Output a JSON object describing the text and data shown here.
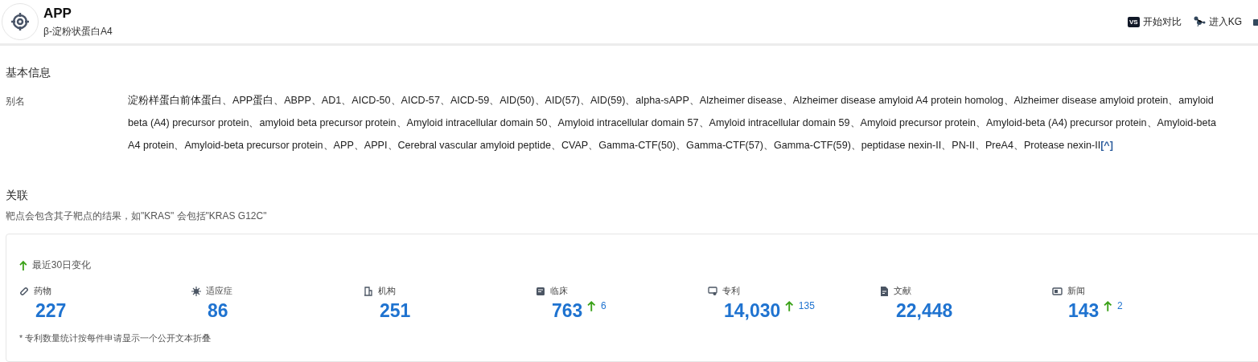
{
  "header": {
    "title": "APP",
    "subtitle": "β-淀粉状蛋白A4",
    "actions": [
      {
        "badge": "VS",
        "label": "开始对比"
      },
      {
        "label": "进入KG"
      }
    ]
  },
  "basic_info": {
    "heading": "基本信息",
    "alias_label": "别名",
    "aliases": "淀粉样蛋白前体蛋白、APP蛋白、ABPP、AD1、AICD-50、AICD-57、AICD-59、AID(50)、AID(57)、AID(59)、alpha-sAPP、Alzheimer disease、Alzheimer disease amyloid A4 protein homolog、Alzheimer disease amyloid protein、amyloid beta (A4) precursor protein、amyloid beta precursor protein、Amyloid intracellular domain 50、Amyloid intracellular domain 57、Amyloid intracellular domain 59、Amyloid precursor protein、Amyloid-beta (A4) precursor protein、Amyloid-beta A4 protein、Amyloid-beta precursor protein、APP、APPI、Cerebral vascular amyloid peptide、CVAP、Gamma-CTF(50)、Gamma-CTF(57)、Gamma-CTF(59)、peptidase nexin-II、PN-II、PreA4、Protease nexin-II",
    "collapse_toggle": "[^]"
  },
  "related": {
    "heading": "关联",
    "note": "靶点会包含其子靶点的结果，如\"KRAS\" 会包括\"KRAS G12C\"",
    "change_legend": "最近30日变化",
    "stats": [
      {
        "label": "药物",
        "value": "227"
      },
      {
        "label": "适应症",
        "value": "86"
      },
      {
        "label": "机构",
        "value": "251"
      },
      {
        "label": "临床",
        "value": "763",
        "change": "6"
      },
      {
        "label": "专利",
        "value": "14,030",
        "change": "135"
      },
      {
        "label": "文献",
        "value": "22,448"
      },
      {
        "label": "新闻",
        "value": "143",
        "change": "2"
      }
    ],
    "footnote": "* 专利数量统计按每件申请显示一个公开文本折叠"
  }
}
